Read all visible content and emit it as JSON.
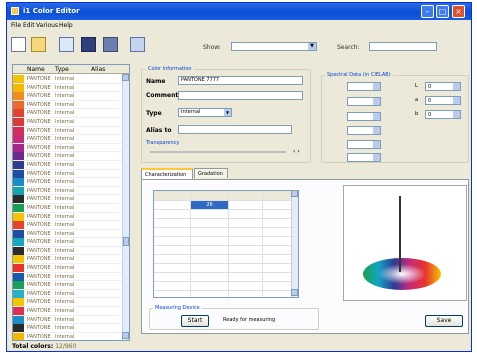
{
  "window": {
    "title": "i1 Color Editor"
  },
  "menu": [
    "File",
    "Edit",
    "Various",
    "Help"
  ],
  "toolbar": {
    "tools": [
      "new-doc-icon",
      "open-folder-icon",
      "copy-icon",
      "save-icon",
      "print-icon",
      "settings-icon"
    ],
    "show_label": "Show:",
    "show_value": "",
    "search_label": "Search:",
    "search_value": ""
  },
  "list": {
    "columns": [
      "Name",
      "Type",
      "Alias"
    ],
    "rows": [
      {
        "name": "PANTONE",
        "type": "Internal",
        "color": "#f5c400"
      },
      {
        "name": "PANTONE",
        "type": "Internal",
        "color": "#f5b800"
      },
      {
        "name": "PANTONE",
        "type": "Internal",
        "color": "#f28a1c"
      },
      {
        "name": "PANTONE",
        "type": "Internal",
        "color": "#ee6a2a"
      },
      {
        "name": "PANTONE",
        "type": "Internal",
        "color": "#e2442e"
      },
      {
        "name": "PANTONE",
        "type": "Internal",
        "color": "#d93a35"
      },
      {
        "name": "PANTONE",
        "type": "Internal",
        "color": "#d82d5a"
      },
      {
        "name": "PANTONE",
        "type": "Internal",
        "color": "#c62a7a"
      },
      {
        "name": "PANTONE",
        "type": "Internal",
        "color": "#a8278f"
      },
      {
        "name": "PANTONE",
        "type": "Internal",
        "color": "#6d2a8e"
      },
      {
        "name": "PANTONE",
        "type": "Internal",
        "color": "#2d3b94"
      },
      {
        "name": "PANTONE",
        "type": "Internal",
        "color": "#1d4ea3"
      },
      {
        "name": "PANTONE",
        "type": "Internal",
        "color": "#1c8cc8"
      },
      {
        "name": "PANTONE",
        "type": "Internal",
        "color": "#16a3b0"
      },
      {
        "name": "PANTONE",
        "type": "Internal",
        "color": "#2a2a2a"
      },
      {
        "name": "PANTONE",
        "type": "Internal",
        "color": "#1a9e57"
      },
      {
        "name": "PANTONE",
        "type": "Internal",
        "color": "#f5c400"
      },
      {
        "name": "PANTONE",
        "type": "Internal",
        "color": "#e3442b"
      },
      {
        "name": "PANTONE",
        "type": "Internal",
        "color": "#1d4ea3"
      },
      {
        "name": "PANTONE",
        "type": "Internal",
        "color": "#17a6c0"
      },
      {
        "name": "PANTONE",
        "type": "Internal",
        "color": "#2b2b2b"
      },
      {
        "name": "PANTONE",
        "type": "Internal",
        "color": "#f4c300"
      },
      {
        "name": "PANTONE",
        "type": "Internal",
        "color": "#e8342d"
      },
      {
        "name": "PANTONE",
        "type": "Internal",
        "color": "#1a5ca8"
      },
      {
        "name": "PANTONE",
        "type": "Internal",
        "color": "#18a05c"
      },
      {
        "name": "PANTONE",
        "type": "Internal",
        "color": "#28b0c8"
      },
      {
        "name": "PANTONE",
        "type": "Internal",
        "color": "#f5c400"
      },
      {
        "name": "PANTONE",
        "type": "Internal",
        "color": "#e02d55"
      },
      {
        "name": "PANTONE",
        "type": "Internal",
        "color": "#1c8cc8"
      },
      {
        "name": "PANTONE",
        "type": "Internal",
        "color": "#2a2a2a"
      },
      {
        "name": "PANTONE",
        "type": "Internal",
        "color": "#f5b800"
      },
      {
        "name": "PANTONE",
        "type": "Internal",
        "color": "#d93a35"
      }
    ]
  },
  "status": {
    "total_label": "Total colors:",
    "total_value": "12/960"
  },
  "info": {
    "group_title": "Color Information",
    "name_label": "Name",
    "name_value": "PANTONE 7777",
    "comment_label": "Comment",
    "type_label": "Type",
    "type_value": "Internal",
    "alias_label": "Alias to",
    "transparency_label": "Transparency"
  },
  "spectral": {
    "group_title": "Spectral Data (in CIELAB)",
    "l_label": "L",
    "a_label": "a",
    "b_label": "b",
    "l_value": "0",
    "a_value": "0",
    "b_value": "0"
  },
  "tabs": [
    "Characterization",
    "Gradation"
  ],
  "grid": {
    "selected_cell": "26"
  },
  "measuring": {
    "group_title": "Measuring Device",
    "start_label": "Start",
    "hint": "Ready for measuring",
    "save_label": "Save"
  }
}
